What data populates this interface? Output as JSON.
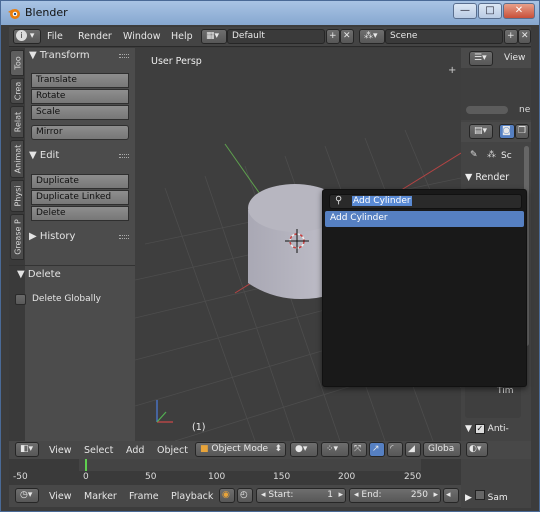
{
  "window": {
    "title": "Blender"
  },
  "info_header": {
    "menus": [
      "File",
      "Render",
      "Window",
      "Help"
    ],
    "screen_layout": "Default",
    "scene": "Scene"
  },
  "tabs": [
    "Too",
    "Crea",
    "Relat",
    "Animat",
    "Physi",
    "Grease P"
  ],
  "tool_shelf": {
    "transform": {
      "title": "Transform",
      "buttons": [
        "Translate",
        "Rotate",
        "Scale",
        "Mirror"
      ]
    },
    "edit": {
      "title": "Edit",
      "buttons": [
        "Duplicate",
        "Duplicate Linked",
        "Delete"
      ]
    },
    "history": {
      "title": "History"
    },
    "delete_panel": {
      "title": "Delete",
      "delete_globally": "Delete Globally"
    }
  },
  "viewport": {
    "view_name": "User Persp",
    "frame": "(1)"
  },
  "search_popup": {
    "query": "Add Cylinder",
    "results": [
      "Add Cylinder"
    ]
  },
  "header_3d": {
    "menus": [
      "View",
      "Select",
      "Add",
      "Object"
    ],
    "mode": "Object Mode",
    "pivot": "Globa"
  },
  "timeline": {
    "ticks": [
      "-50",
      "0",
      "50",
      "100",
      "150",
      "200",
      "250"
    ]
  },
  "timeline_header": {
    "menus": [
      "View",
      "Marker",
      "Frame",
      "Playback"
    ],
    "start_label": "Start:",
    "start_value": "1",
    "end_label": "End:",
    "end_value": "250"
  },
  "properties": {
    "view_label": "View",
    "scene_tab": "Sc",
    "render_panel": "Render",
    "time_label": "Tim",
    "anti_label": "Anti-",
    "sam_label": "Sam",
    "partial_ne": "ne"
  },
  "colors": {
    "accent": "#5680c2",
    "viewport_bg": "#3e3e3e",
    "popup_bg": "#191919",
    "highlight": "#5a8ad4"
  }
}
